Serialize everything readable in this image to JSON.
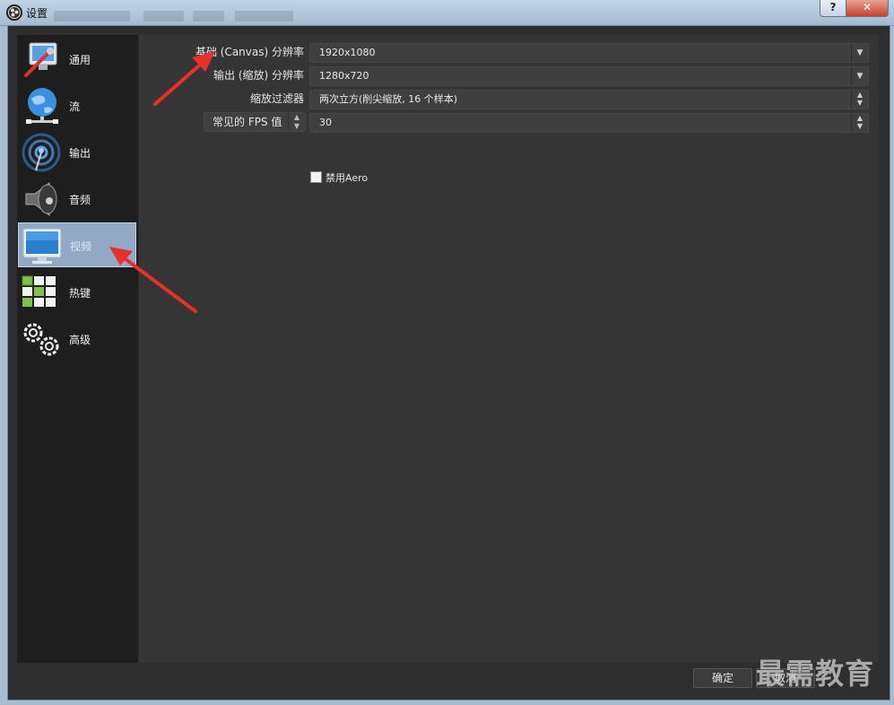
{
  "window": {
    "title": "设置",
    "help_label": "?",
    "close_label": "✕"
  },
  "sidebar": {
    "items": [
      {
        "label": "通用",
        "icon": "general-settings-icon"
      },
      {
        "label": "流",
        "icon": "globe-network-icon"
      },
      {
        "label": "输出",
        "icon": "broadcast-antenna-icon"
      },
      {
        "label": "音频",
        "icon": "speaker-icon"
      },
      {
        "label": "视频",
        "icon": "monitor-icon",
        "active": true
      },
      {
        "label": "热键",
        "icon": "keyboard-keys-icon"
      },
      {
        "label": "高级",
        "icon": "gears-icon"
      }
    ]
  },
  "video": {
    "base_resolution_label": "基础 (Canvas) 分辨率",
    "base_resolution_value": "1920x1080",
    "output_resolution_label": "输出 (缩放) 分辨率",
    "output_resolution_value": "1280x720",
    "downscale_filter_label": "缩放过滤器",
    "downscale_filter_value": "两次立方(削尖缩放, 16 个样本)",
    "fps_type_label": "常见的 FPS 值",
    "fps_value": "30",
    "disable_aero_label": "禁用Aero",
    "disable_aero_checked": false
  },
  "footer": {
    "ok_label": "确定",
    "cancel_label": "取消"
  },
  "watermark": "最需教育",
  "colors": {
    "accent_arrow": "#e8302b",
    "active_item": "#92a9c6",
    "panel": "#353535",
    "sidebar": "#1e1e1e"
  }
}
